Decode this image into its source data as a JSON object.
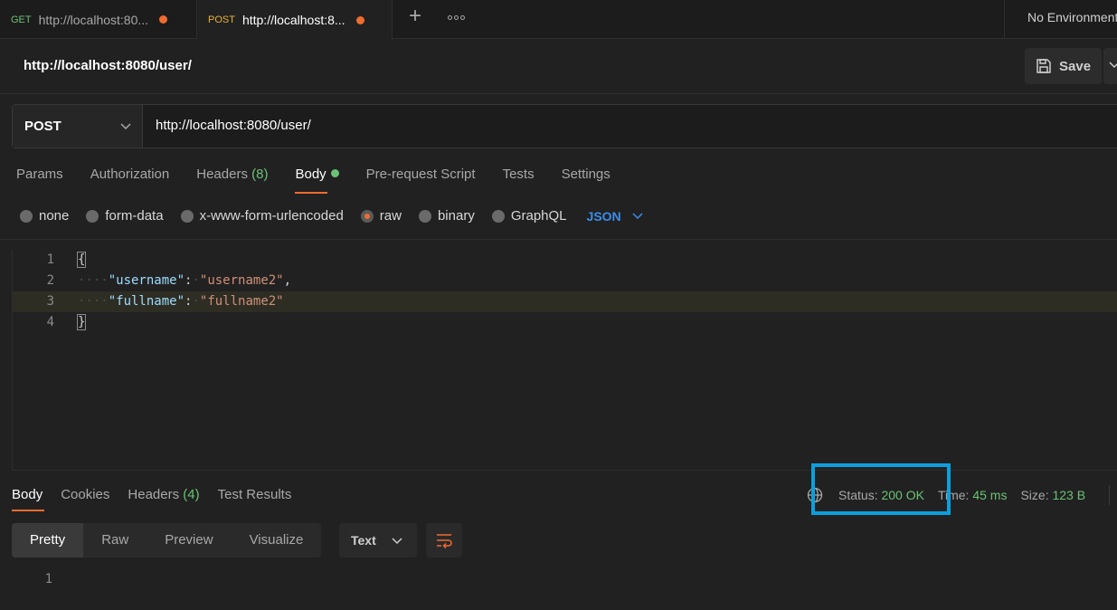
{
  "tabs": [
    {
      "method": "GET",
      "url": "http://localhost:80..."
    },
    {
      "method": "POST",
      "url": "http://localhost:8..."
    }
  ],
  "environment": "No Environment",
  "request": {
    "title": "http://localhost:8080/user/",
    "save_label": "Save",
    "method": "POST",
    "url": "http://localhost:8080/user/"
  },
  "request_tabs": {
    "params": "Params",
    "authorization": "Authorization",
    "headers": "Headers",
    "headers_count": "(8)",
    "body": "Body",
    "pre_request": "Pre-request Script",
    "tests": "Tests",
    "settings": "Settings"
  },
  "body_types": {
    "none": "none",
    "form_data": "form-data",
    "urlencoded": "x-www-form-urlencoded",
    "raw": "raw",
    "binary": "binary",
    "graphql": "GraphQL",
    "format": "JSON"
  },
  "editor": {
    "line_numbers": [
      "1",
      "2",
      "3",
      "4"
    ],
    "open_brace": "{",
    "close_brace": "}",
    "indent": "····",
    "line2_key": "\"username\"",
    "line2_value": "\"username2\"",
    "line3_key": "\"fullname\"",
    "line3_value": "\"fullname2\""
  },
  "response": {
    "tabs": {
      "body": "Body",
      "cookies": "Cookies",
      "headers": "Headers",
      "headers_count": "(4)",
      "test_results": "Test Results"
    },
    "status_label": "Status:",
    "status_value": "200 OK",
    "time_label": "Time:",
    "time_value": "45 ms",
    "size_label": "Size:",
    "size_value": "123 B",
    "views": {
      "pretty": "Pretty",
      "raw": "Raw",
      "preview": "Preview",
      "visualize": "Visualize"
    },
    "format": "Text",
    "line_number": "1"
  },
  "colors": {
    "accent": "#ef6c2f",
    "success": "#6bc275",
    "link": "#3a8eeb",
    "highlight_box": "#0aa0e0"
  }
}
